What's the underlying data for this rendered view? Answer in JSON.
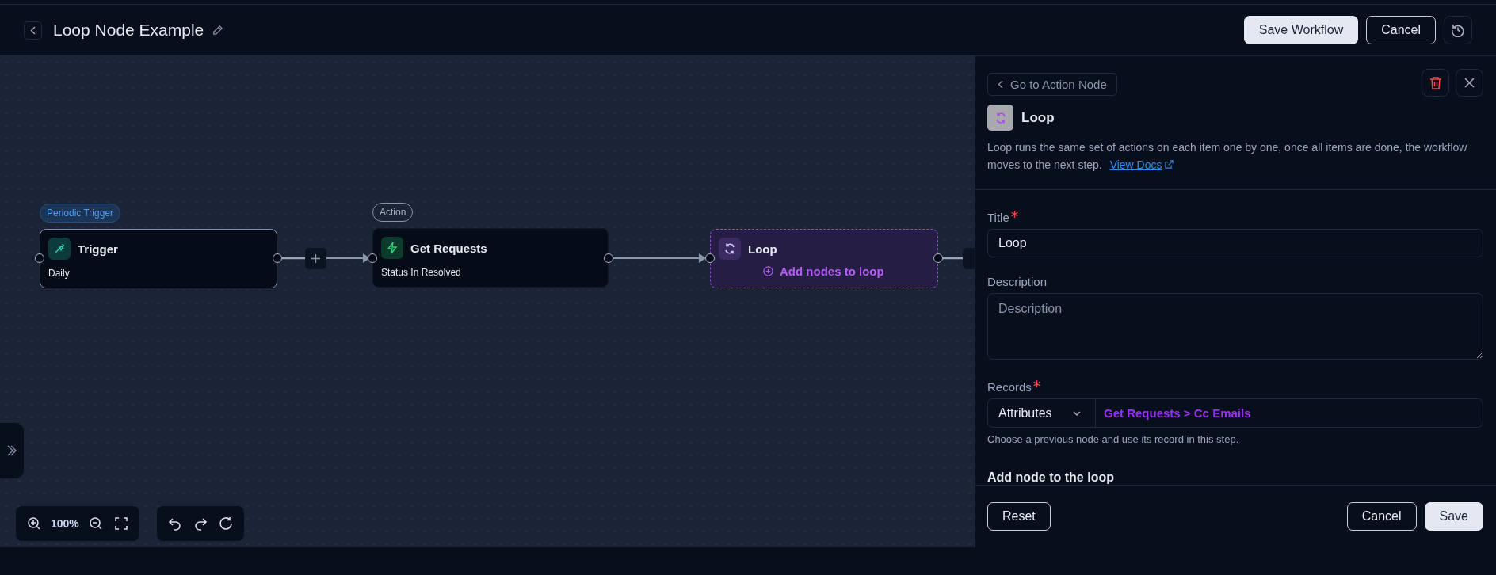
{
  "header": {
    "title": "Loop Node Example",
    "buttons": [
      {
        "label": "Save Workflow",
        "kind": "primary"
      },
      {
        "label": "Cancel",
        "kind": "outline"
      }
    ]
  },
  "canvas": {
    "nodes": [
      {
        "kind": "trigger",
        "badge": "Periodic Trigger",
        "title": "Trigger",
        "subtitle": "Daily"
      },
      {
        "kind": "action",
        "badge": "Action",
        "title": "Get Requests",
        "subtitle": "Status In Resolved"
      },
      {
        "kind": "loop",
        "title": "Loop",
        "add_label": "Add nodes to loop"
      }
    ],
    "zoom": "100%"
  },
  "panel": {
    "back_label": "Go to Action Node",
    "title": "Loop",
    "description": "Loop runs the same set of actions on each item one by one, once all items are done, the workflow moves to the next step.",
    "docs_link": "View Docs",
    "fields": [
      {
        "kind": "input",
        "label": "Title",
        "required": true,
        "value": "Loop"
      },
      {
        "kind": "textarea",
        "label": "Description",
        "placeholder": "Description"
      },
      {
        "kind": "record",
        "label": "Records",
        "required": true,
        "select": "Attributes",
        "value": "Get Requests > Cc Emails",
        "hint": "Choose a previous node and use its record in this step."
      }
    ],
    "section": "Add node to the loop",
    "footer": {
      "reset": "Reset",
      "cancel": "Cancel",
      "save": "Save"
    }
  }
}
